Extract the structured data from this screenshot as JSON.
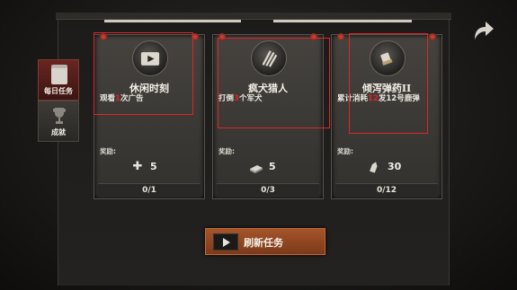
{
  "side_tabs": [
    {
      "label": "每日任务",
      "icon": "clipboard-icon",
      "active": true
    },
    {
      "label": "成就",
      "icon": "trophy-icon",
      "active": false
    }
  ],
  "missions": [
    {
      "title": "休闲时刻",
      "desc_before": "观看",
      "desc_num": "1",
      "desc_after": "次广告",
      "reward_label": "奖励:",
      "reward_icon": "puzzle-icon",
      "reward_value": "5",
      "progress": "0/1",
      "icon": "video-icon"
    },
    {
      "title": "疯犬猎人",
      "desc_before": "打倒",
      "desc_num": "3",
      "desc_after": "个军犬",
      "reward_label": "奖励:",
      "reward_icon": "ammo-box-icon",
      "reward_value": "5",
      "progress": "0/3",
      "icon": "claw-scratch-icon"
    },
    {
      "title": "倾泻弹药II",
      "desc_before": "累计消耗",
      "desc_num": "12",
      "desc_after": "发12号鹿弹",
      "reward_label": "奖励:",
      "reward_icon": "bullet-icon",
      "reward_value": "30",
      "progress": "0/12",
      "icon": "shotgun-shell-icon"
    }
  ],
  "refresh_button": {
    "label": "刷新任务",
    "icon": "video-icon"
  },
  "back_button": {
    "icon": "back-arrow-icon"
  },
  "colors": {
    "highlight": "#e0242a",
    "button": "#9a4c24",
    "active_tab": "#5a201a"
  }
}
